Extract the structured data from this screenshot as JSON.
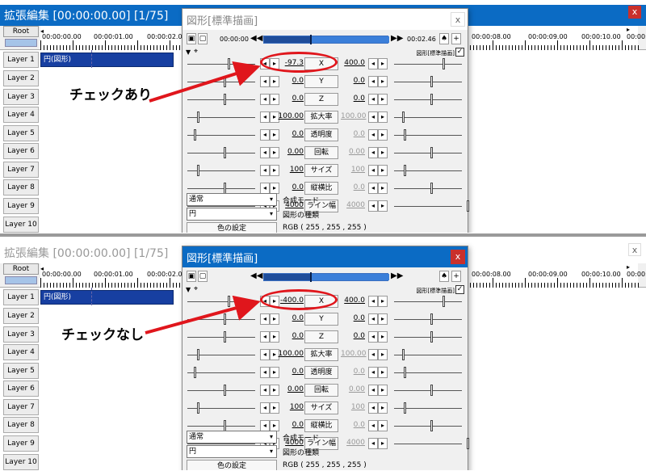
{
  "timeline": {
    "title": "拡張編集 [00:00:00.00] [1/75]",
    "close_label": "x",
    "root_label": "Root",
    "ticks": [
      "00:00:00.00",
      "00:00:01.00",
      "00:00:02.00",
      "00:00:08.00",
      "00:00:09.00",
      "00:00:10.00",
      "00:00:"
    ],
    "layers": [
      "Layer 1",
      "Layer 2",
      "Layer 3",
      "Layer 4",
      "Layer 5",
      "Layer 6",
      "Layer 7",
      "Layer 8",
      "Layer 9",
      "Layer 10"
    ],
    "clip_label": "円(図形)"
  },
  "dialog": {
    "title": "図形[標準描画]",
    "close_label": "x",
    "time_start": "00:00:00",
    "time_end": "00:02.46",
    "header_label": "図形[標準描画]",
    "checkbox_mark": "✓",
    "params": [
      {
        "name": "X",
        "right": "400.0",
        "right_gray": false
      },
      {
        "name": "Y",
        "left": "0.0",
        "right": "0.0",
        "right_gray": false
      },
      {
        "name": "Z",
        "left": "0.0",
        "right": "0.0",
        "right_gray": false
      },
      {
        "name": "拡大率",
        "left": "100.00",
        "right": "100.00",
        "right_gray": true
      },
      {
        "name": "透明度",
        "left": "0.0",
        "right": "0.0",
        "right_gray": true
      },
      {
        "name": "回転",
        "left": "0.00",
        "right": "0.00",
        "right_gray": true
      },
      {
        "name": "サイズ",
        "left": "100",
        "right": "100",
        "right_gray": true
      },
      {
        "name": "縦横比",
        "left": "0.0",
        "right": "0.0",
        "right_gray": true
      },
      {
        "name": "ライン幅",
        "left": "4000",
        "right": "4000",
        "right_gray": true
      }
    ],
    "blend_value": "通常",
    "blend_label": "合成モード",
    "shape_value": "円",
    "shape_label": "図形の種類",
    "color_button": "色の設定",
    "rgb": "RGB ( 255 , 255 , 255 )"
  },
  "top": {
    "x_left": "-97.3",
    "annotation": "チェックあり"
  },
  "bottom": {
    "x_left": "-400.0",
    "annotation": "チェックなし"
  },
  "colors": {
    "accent": "#0b6bc4",
    "highlight": "#e0161c",
    "clip": "#173fa1"
  }
}
